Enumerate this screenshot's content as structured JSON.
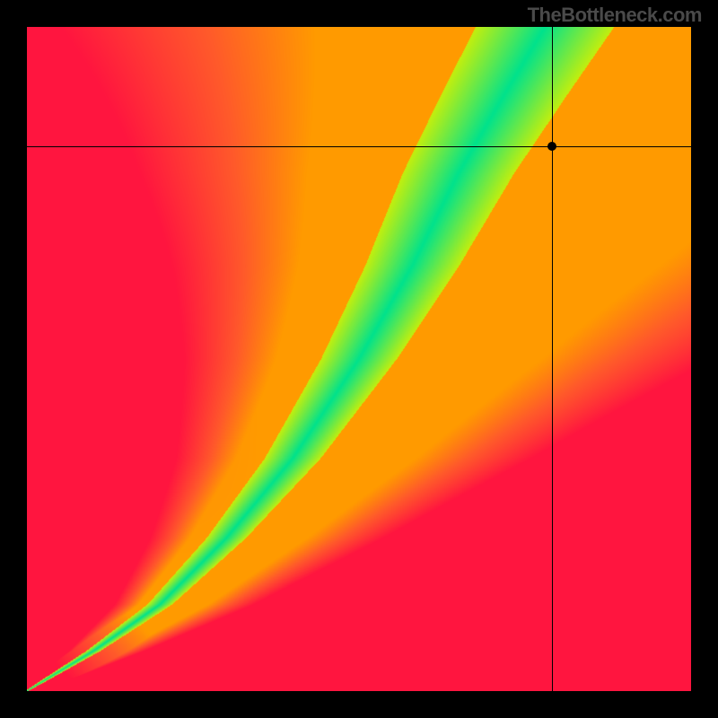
{
  "watermark": "TheBottleneck.com",
  "chart_data": {
    "type": "heatmap",
    "title": "",
    "xlabel": "",
    "ylabel": "",
    "xlim": [
      0,
      1
    ],
    "ylim": [
      0,
      1
    ],
    "axes_visible": false,
    "grid": false,
    "description": "Bottleneck heatmap. A green optimal-balance ridge curves from the bottom-left corner up to the top, bending right as it rises, flanked by a yellow band, fading to orange then red away from the ridge. Color encodes bottleneck severity: green ≈ 0 (balanced), red ≈ 1 (severe).",
    "colorscale": [
      {
        "value": 0.0,
        "color": "#00e28c"
      },
      {
        "value": 0.2,
        "color": "#d8f000"
      },
      {
        "value": 0.35,
        "color": "#ffe000"
      },
      {
        "value": 0.55,
        "color": "#ff9a00"
      },
      {
        "value": 0.75,
        "color": "#ff5a2a"
      },
      {
        "value": 1.0,
        "color": "#ff153f"
      }
    ],
    "optimal_ridge_samples": [
      {
        "x": 0.0,
        "y": 0.0
      },
      {
        "x": 0.1,
        "y": 0.06
      },
      {
        "x": 0.2,
        "y": 0.13
      },
      {
        "x": 0.3,
        "y": 0.23
      },
      {
        "x": 0.4,
        "y": 0.35
      },
      {
        "x": 0.5,
        "y": 0.5
      },
      {
        "x": 0.58,
        "y": 0.64
      },
      {
        "x": 0.65,
        "y": 0.78
      },
      {
        "x": 0.72,
        "y": 0.9
      },
      {
        "x": 0.78,
        "y": 1.0
      }
    ],
    "marker": {
      "x": 0.79,
      "y": 0.82
    },
    "crosshair": {
      "x": 0.79,
      "y": 0.82
    }
  }
}
